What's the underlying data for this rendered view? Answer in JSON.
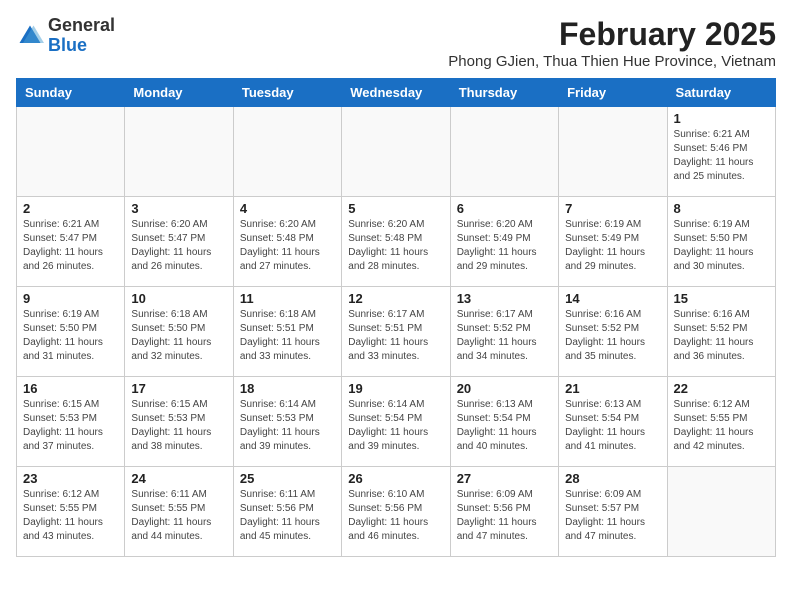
{
  "header": {
    "logo_general": "General",
    "logo_blue": "Blue",
    "title": "February 2025",
    "subtitle": "Phong GJien, Thua Thien Hue Province, Vietnam"
  },
  "calendar": {
    "days_of_week": [
      "Sunday",
      "Monday",
      "Tuesday",
      "Wednesday",
      "Thursday",
      "Friday",
      "Saturday"
    ],
    "weeks": [
      [
        {
          "day": "",
          "info": ""
        },
        {
          "day": "",
          "info": ""
        },
        {
          "day": "",
          "info": ""
        },
        {
          "day": "",
          "info": ""
        },
        {
          "day": "",
          "info": ""
        },
        {
          "day": "",
          "info": ""
        },
        {
          "day": "1",
          "info": "Sunrise: 6:21 AM\nSunset: 5:46 PM\nDaylight: 11 hours and 25 minutes."
        }
      ],
      [
        {
          "day": "2",
          "info": "Sunrise: 6:21 AM\nSunset: 5:47 PM\nDaylight: 11 hours and 26 minutes."
        },
        {
          "day": "3",
          "info": "Sunrise: 6:20 AM\nSunset: 5:47 PM\nDaylight: 11 hours and 26 minutes."
        },
        {
          "day": "4",
          "info": "Sunrise: 6:20 AM\nSunset: 5:48 PM\nDaylight: 11 hours and 27 minutes."
        },
        {
          "day": "5",
          "info": "Sunrise: 6:20 AM\nSunset: 5:48 PM\nDaylight: 11 hours and 28 minutes."
        },
        {
          "day": "6",
          "info": "Sunrise: 6:20 AM\nSunset: 5:49 PM\nDaylight: 11 hours and 29 minutes."
        },
        {
          "day": "7",
          "info": "Sunrise: 6:19 AM\nSunset: 5:49 PM\nDaylight: 11 hours and 29 minutes."
        },
        {
          "day": "8",
          "info": "Sunrise: 6:19 AM\nSunset: 5:50 PM\nDaylight: 11 hours and 30 minutes."
        }
      ],
      [
        {
          "day": "9",
          "info": "Sunrise: 6:19 AM\nSunset: 5:50 PM\nDaylight: 11 hours and 31 minutes."
        },
        {
          "day": "10",
          "info": "Sunrise: 6:18 AM\nSunset: 5:50 PM\nDaylight: 11 hours and 32 minutes."
        },
        {
          "day": "11",
          "info": "Sunrise: 6:18 AM\nSunset: 5:51 PM\nDaylight: 11 hours and 33 minutes."
        },
        {
          "day": "12",
          "info": "Sunrise: 6:17 AM\nSunset: 5:51 PM\nDaylight: 11 hours and 33 minutes."
        },
        {
          "day": "13",
          "info": "Sunrise: 6:17 AM\nSunset: 5:52 PM\nDaylight: 11 hours and 34 minutes."
        },
        {
          "day": "14",
          "info": "Sunrise: 6:16 AM\nSunset: 5:52 PM\nDaylight: 11 hours and 35 minutes."
        },
        {
          "day": "15",
          "info": "Sunrise: 6:16 AM\nSunset: 5:52 PM\nDaylight: 11 hours and 36 minutes."
        }
      ],
      [
        {
          "day": "16",
          "info": "Sunrise: 6:15 AM\nSunset: 5:53 PM\nDaylight: 11 hours and 37 minutes."
        },
        {
          "day": "17",
          "info": "Sunrise: 6:15 AM\nSunset: 5:53 PM\nDaylight: 11 hours and 38 minutes."
        },
        {
          "day": "18",
          "info": "Sunrise: 6:14 AM\nSunset: 5:53 PM\nDaylight: 11 hours and 39 minutes."
        },
        {
          "day": "19",
          "info": "Sunrise: 6:14 AM\nSunset: 5:54 PM\nDaylight: 11 hours and 39 minutes."
        },
        {
          "day": "20",
          "info": "Sunrise: 6:13 AM\nSunset: 5:54 PM\nDaylight: 11 hours and 40 minutes."
        },
        {
          "day": "21",
          "info": "Sunrise: 6:13 AM\nSunset: 5:54 PM\nDaylight: 11 hours and 41 minutes."
        },
        {
          "day": "22",
          "info": "Sunrise: 6:12 AM\nSunset: 5:55 PM\nDaylight: 11 hours and 42 minutes."
        }
      ],
      [
        {
          "day": "23",
          "info": "Sunrise: 6:12 AM\nSunset: 5:55 PM\nDaylight: 11 hours and 43 minutes."
        },
        {
          "day": "24",
          "info": "Sunrise: 6:11 AM\nSunset: 5:55 PM\nDaylight: 11 hours and 44 minutes."
        },
        {
          "day": "25",
          "info": "Sunrise: 6:11 AM\nSunset: 5:56 PM\nDaylight: 11 hours and 45 minutes."
        },
        {
          "day": "26",
          "info": "Sunrise: 6:10 AM\nSunset: 5:56 PM\nDaylight: 11 hours and 46 minutes."
        },
        {
          "day": "27",
          "info": "Sunrise: 6:09 AM\nSunset: 5:56 PM\nDaylight: 11 hours and 47 minutes."
        },
        {
          "day": "28",
          "info": "Sunrise: 6:09 AM\nSunset: 5:57 PM\nDaylight: 11 hours and 47 minutes."
        },
        {
          "day": "",
          "info": ""
        }
      ]
    ]
  }
}
